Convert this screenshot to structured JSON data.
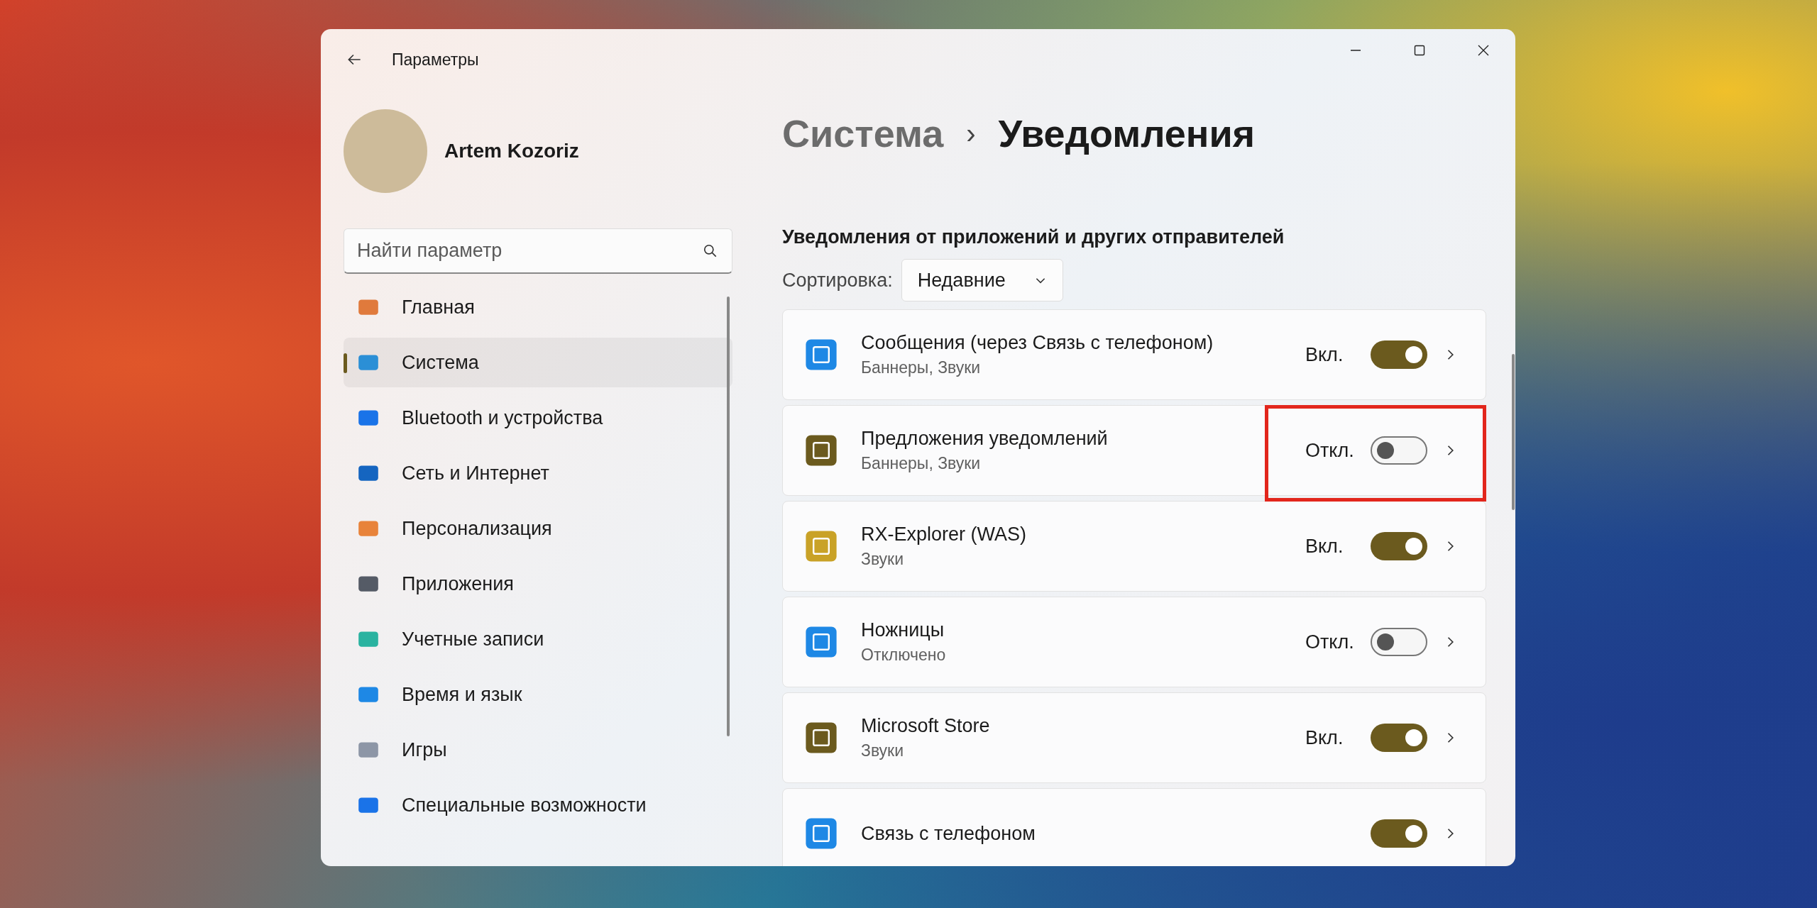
{
  "window": {
    "title": "Параметры"
  },
  "user": {
    "name": "Artem Kozoriz"
  },
  "search": {
    "placeholder": "Найти параметр"
  },
  "sidebar": {
    "items": [
      {
        "label": "Главная",
        "selected": false
      },
      {
        "label": "Система",
        "selected": true
      },
      {
        "label": "Bluetooth и устройства",
        "selected": false
      },
      {
        "label": "Сеть и Интернет",
        "selected": false
      },
      {
        "label": "Персонализация",
        "selected": false
      },
      {
        "label": "Приложения",
        "selected": false
      },
      {
        "label": "Учетные записи",
        "selected": false
      },
      {
        "label": "Время и язык",
        "selected": false
      },
      {
        "label": "Игры",
        "selected": false
      },
      {
        "label": "Специальные возможности",
        "selected": false
      }
    ]
  },
  "breadcrumb": {
    "parent": "Система",
    "separator": "›",
    "current": "Уведомления"
  },
  "section": {
    "heading": "Уведомления от приложений и других отправителей"
  },
  "sort": {
    "label": "Сортировка:",
    "value": "Недавние"
  },
  "apps": [
    {
      "name": "Сообщения (через Связь с телефоном)",
      "detail": "Баннеры, Звуки",
      "state": "Вкл.",
      "on": true,
      "highlighted": false
    },
    {
      "name": "Предложения уведомлений",
      "detail": "Баннеры, Звуки",
      "state": "Откл.",
      "on": false,
      "highlighted": true
    },
    {
      "name": "RX-Explorer (WAS)",
      "detail": "Звуки",
      "state": "Вкл.",
      "on": true,
      "highlighted": false
    },
    {
      "name": "Ножницы",
      "detail": "Отключено",
      "state": "Откл.",
      "on": false,
      "highlighted": false
    },
    {
      "name": "Microsoft Store",
      "detail": "Звуки",
      "state": "Вкл.",
      "on": true,
      "highlighted": false
    },
    {
      "name": "Связь с телефоном",
      "on": true,
      "highlighted": false
    }
  ]
}
